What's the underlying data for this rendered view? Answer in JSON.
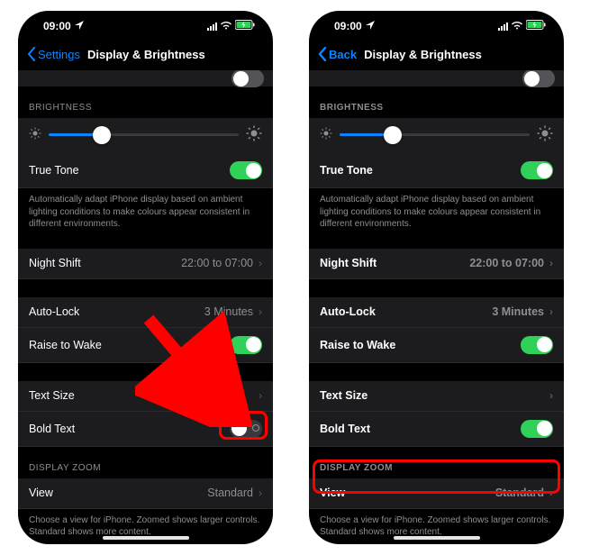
{
  "colors": {
    "accent": "#0a84ff",
    "toggle_on": "#30d158",
    "highlight": "#ff0000"
  },
  "status": {
    "time": "09:00"
  },
  "left_phone": {
    "back_label": "Settings",
    "title": "Display & Brightness",
    "brightness_header": "BRIGHTNESS",
    "true_tone_label": "True Tone",
    "true_tone_desc": "Automatically adapt iPhone display based on ambient lighting conditions to make colours appear consistent in different environments.",
    "night_shift_label": "Night Shift",
    "night_shift_value": "22:00 to 07:00",
    "auto_lock_label": "Auto-Lock",
    "auto_lock_value": "3 Minutes",
    "raise_to_wake_label": "Raise to Wake",
    "text_size_label": "Text Size",
    "bold_text_label": "Bold Text",
    "display_zoom_header": "DISPLAY ZOOM",
    "view_label": "View",
    "view_value": "Standard",
    "zoom_desc": "Choose a view for iPhone. Zoomed shows larger controls. Standard shows more content.",
    "bold_text_on": false
  },
  "right_phone": {
    "back_label": "Back",
    "title": "Display & Brightness",
    "brightness_header": "BRIGHTNESS",
    "true_tone_label": "True Tone",
    "true_tone_desc": "Automatically adapt iPhone display based on ambient lighting conditions to make colours appear consistent in different environments.",
    "night_shift_label": "Night Shift",
    "night_shift_value": "22:00 to 07:00",
    "auto_lock_label": "Auto-Lock",
    "auto_lock_value": "3 Minutes",
    "raise_to_wake_label": "Raise to Wake",
    "text_size_label": "Text Size",
    "bold_text_label": "Bold Text",
    "display_zoom_header": "DISPLAY ZOOM",
    "view_label": "View",
    "view_value": "Standard",
    "zoom_desc": "Choose a view for iPhone. Zoomed shows larger controls. Standard shows more content.",
    "bold_text_on": true
  }
}
